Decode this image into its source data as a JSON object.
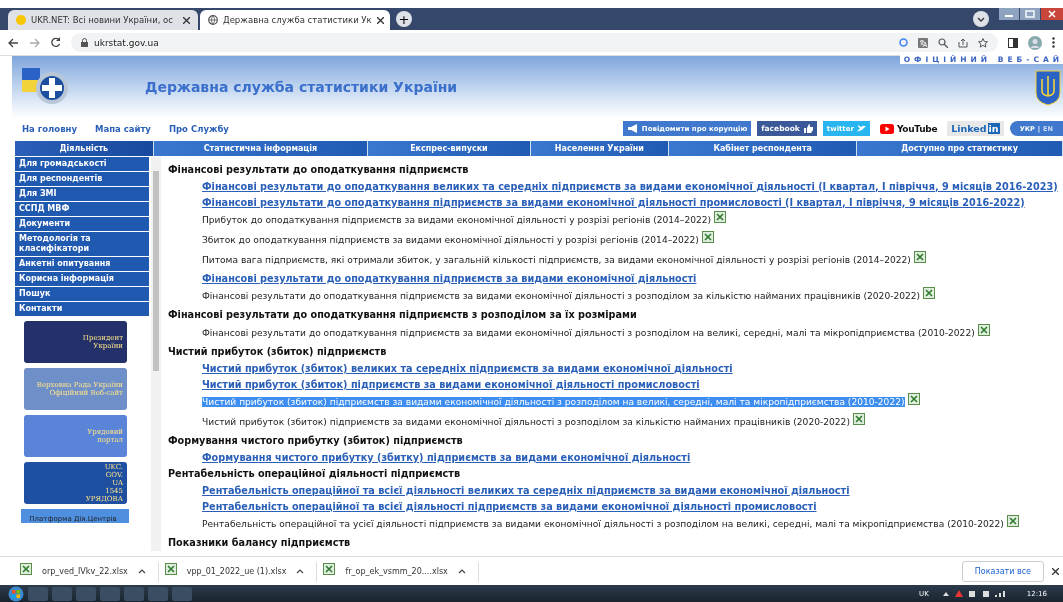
{
  "browser": {
    "tabs": [
      {
        "title": "UKR.NET: Всі новини України, ос",
        "selected": false
      },
      {
        "title": "Державна служба статистики Ук",
        "selected": true
      }
    ],
    "new_tab": "+",
    "url": "ukrstat.gov.ua"
  },
  "site": {
    "tagline": "ОФІЦІЙНИЙ ВЕБ-САЙ",
    "title": "Державна служба статистики України",
    "top_links": [
      "На головну",
      "Мапа сайту",
      "Про Службу"
    ],
    "social": [
      {
        "kind": "corruption",
        "label": "Повідомити про корупцію"
      },
      {
        "kind": "facebook",
        "label": "facebook"
      },
      {
        "kind": "twitter",
        "label": "twitter"
      },
      {
        "kind": "youtube",
        "label": "YouTube"
      },
      {
        "kind": "linkedin",
        "label": "Linked",
        "suffix": "in"
      },
      {
        "kind": "lang",
        "options": [
          {
            "label": "УКР",
            "selected": true
          },
          {
            "label": "EN",
            "selected": false
          }
        ],
        "separator": "|"
      }
    ],
    "nav": [
      {
        "label": "Діяльність",
        "selected": true
      },
      {
        "label": "Статистична інформація",
        "selected": false
      },
      {
        "label": "Експрес-випуски",
        "selected": false
      },
      {
        "label": "Населення України",
        "selected": false
      },
      {
        "label": "Кабінет респондента",
        "selected": false
      },
      {
        "label": "Доступно про статистику",
        "selected": false
      }
    ]
  },
  "sidebar": {
    "items": [
      "Для громадськості",
      "Для респондентів",
      "Для ЗМІ",
      "ССПД МВФ",
      "Документи",
      "Методологія та класифікатори",
      "Анкетні опитування",
      "Корисна інформація",
      "Пошук",
      "Контакти"
    ],
    "banners": [
      {
        "lines": [
          "Президент",
          "України"
        ],
        "color": "#23306a"
      },
      {
        "lines": [
          "Верховна Рада України",
          "Офіційний Веб-сайт"
        ],
        "color": "#6f8fc8"
      },
      {
        "lines": [
          "Урядовий",
          "портал"
        ],
        "color": "#5a84d8"
      },
      {
        "lines": [
          "UKC.",
          "GOV.",
          "UA",
          "1545",
          "УРЯДОВА"
        ],
        "color": "#1f4fa0"
      },
      {
        "lines": [
          "Платформа Дія.Центрів"
        ],
        "color": "#4f8fe0"
      }
    ]
  },
  "content": {
    "items": [
      {
        "kind": "heading",
        "text": "Фінансові результати до оподаткування підприємств",
        "selected": false
      },
      {
        "kind": "link",
        "text": "Фінансові результати до оподаткування великих та середніх підприємств за видами економічної діяльності (I квартал, I півріччя, 9 місяців 2016-2023)",
        "selected": false
      },
      {
        "kind": "link",
        "text": "Фінансові результати до оподаткування підприємств за видами економічної діяльності промисловості (I квартал, I півріччя, 9 місяців 2016-2022)",
        "selected": false
      },
      {
        "kind": "file",
        "text": "Прибуток до оподаткування підприємств за видами економічної діяльності у розрізі регіонів (2014–2022)",
        "selected": false
      },
      {
        "kind": "file",
        "text": "Збиток до оподаткування підприємств за видами економічної діяльності у розрізі регіонів (2014–2022)",
        "selected": false
      },
      {
        "kind": "file",
        "text": "Питома вага підприємств, які отримали збиток, у загальній кількості підприємств, за видами економічної діяльності у розрізі регіонів (2014–2022)",
        "selected": false
      },
      {
        "kind": "link",
        "text": "Фінансові результати до оподаткування підприємств за видами економічної діяльності",
        "selected": false
      },
      {
        "kind": "file",
        "text": "Фінансові результати до оподаткування підприємств за видами економічної діяльності з розподілом за кількістю найманих працівників (2020-2022)",
        "selected": false
      },
      {
        "kind": "heading",
        "text": "Фінансові результати до оподаткування підприємств з розподілом за їх розмірами",
        "selected": false
      },
      {
        "kind": "file",
        "text": "Фінансові результати до оподаткування підприємств за видами економічної діяльності з розподілом на великі, середні, малі та мікропідприємства (2010-2022)",
        "selected": false
      },
      {
        "kind": "heading",
        "text": "Чистий прибуток (збиток) підприємств",
        "selected": false
      },
      {
        "kind": "link",
        "text": "Чистий прибуток (збиток) великих та середніх підприємств за видами економічної діяльності",
        "selected": false
      },
      {
        "kind": "link",
        "text": "Чистий прибуток (збиток)  підприємств за видами економічної діяльності промисловості",
        "selected": false
      },
      {
        "kind": "file",
        "text": "Чистий прибуток (збиток) підприємств за видами економічної діяльності з розподілом на великі, середні, малі та мікропідприємства (2010-2022)",
        "selected": true
      },
      {
        "kind": "file",
        "text": "Чистий прибуток (збиток) підприємств за видами економічної діяльності з розподілом за кількістю найманих працівників (2020-2022)",
        "selected": false
      },
      {
        "kind": "heading",
        "text": "Формування чистого прибутку (збиток) підприємств",
        "selected": false
      },
      {
        "kind": "link",
        "text": "Формування чистого прибутку (збитку) підприємств за видами економічної діяльності",
        "selected": false
      },
      {
        "kind": "heading",
        "text": "Рентабельність операційної діяльності підприємств",
        "selected": false
      },
      {
        "kind": "link",
        "text": "Рентабельність операційної та всієї діяльності великих та середніх підприємств за видами економічної діяльності",
        "selected": false
      },
      {
        "kind": "link",
        "text": "Рентабельність операційної та всієї діяльності  підприємств  за видами економічної діяльності промисловості",
        "selected": false
      },
      {
        "kind": "file",
        "text": "Рентабельність операційної та усієї діяльності підприємств за видами економічної діяльності з розподілом на великі, середні, малі та мікропідприємства (2010-2022)",
        "selected": false
      },
      {
        "kind": "heading",
        "text": "Показники балансу підприємств",
        "selected": false
      }
    ]
  },
  "downloads": {
    "files": [
      "orp_ved_IVkv_22.xlsx",
      "vpp_01_2022_ue (1).xlsx",
      "fr_op_ek_vsmm_20....xlsx"
    ],
    "show_all": "Показати все"
  },
  "taskbar": {
    "language": "UK",
    "time": "12:16"
  }
}
